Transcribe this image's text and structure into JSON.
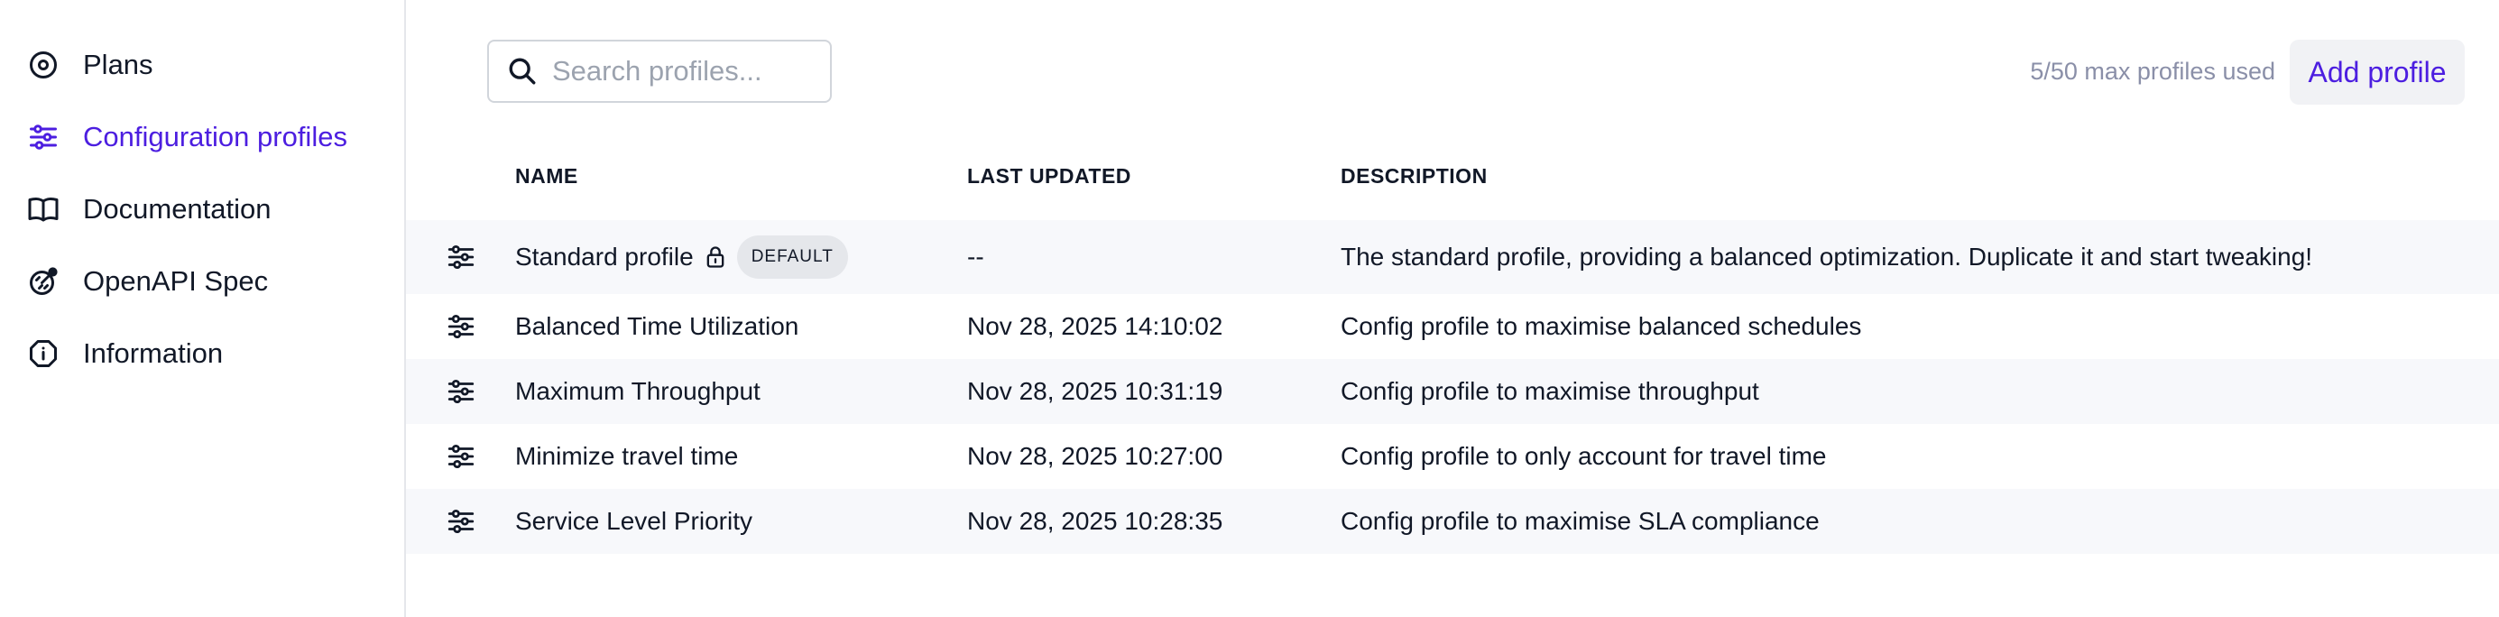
{
  "sidebar": {
    "items": [
      {
        "label": "Plans",
        "icon": "target-icon",
        "active": false
      },
      {
        "label": "Configuration profiles",
        "icon": "sliders-icon",
        "active": true
      },
      {
        "label": "Documentation",
        "icon": "book-icon",
        "active": false
      },
      {
        "label": "OpenAPI Spec",
        "icon": "api-icon",
        "active": false
      },
      {
        "label": "Information",
        "icon": "info-icon",
        "active": false
      }
    ]
  },
  "toolbar": {
    "search_placeholder": "Search profiles...",
    "search_value": "",
    "quota_text": "5/50 max profiles used",
    "add_label": "Add profile"
  },
  "table": {
    "headers": {
      "name": "NAME",
      "last_updated": "LAST UPDATED",
      "description": "DESCRIPTION"
    },
    "rows": [
      {
        "name": "Standard profile",
        "locked": true,
        "badge": "DEFAULT",
        "last_updated": "--",
        "description": "The standard profile, providing a balanced optimization. Duplicate it and start tweaking!"
      },
      {
        "name": "Balanced Time Utilization",
        "last_updated": "Nov 28, 2025 14:10:02",
        "description": "Config profile to maximise balanced schedules"
      },
      {
        "name": "Maximum Throughput",
        "last_updated": "Nov 28, 2025 10:31:19",
        "description": "Config profile to maximise throughput"
      },
      {
        "name": "Minimize travel time",
        "last_updated": "Nov 28, 2025 10:27:00",
        "description": "Config profile to only account for travel time"
      },
      {
        "name": "Service Level Priority",
        "last_updated": "Nov 28, 2025 10:28:35",
        "description": "Config profile to maximise SLA compliance"
      }
    ]
  },
  "colors": {
    "accent": "#4c1ee0",
    "muted_text": "#8a8fa8",
    "row_shade": "#f7f8fb",
    "badge_bg": "#e5e7eb"
  }
}
